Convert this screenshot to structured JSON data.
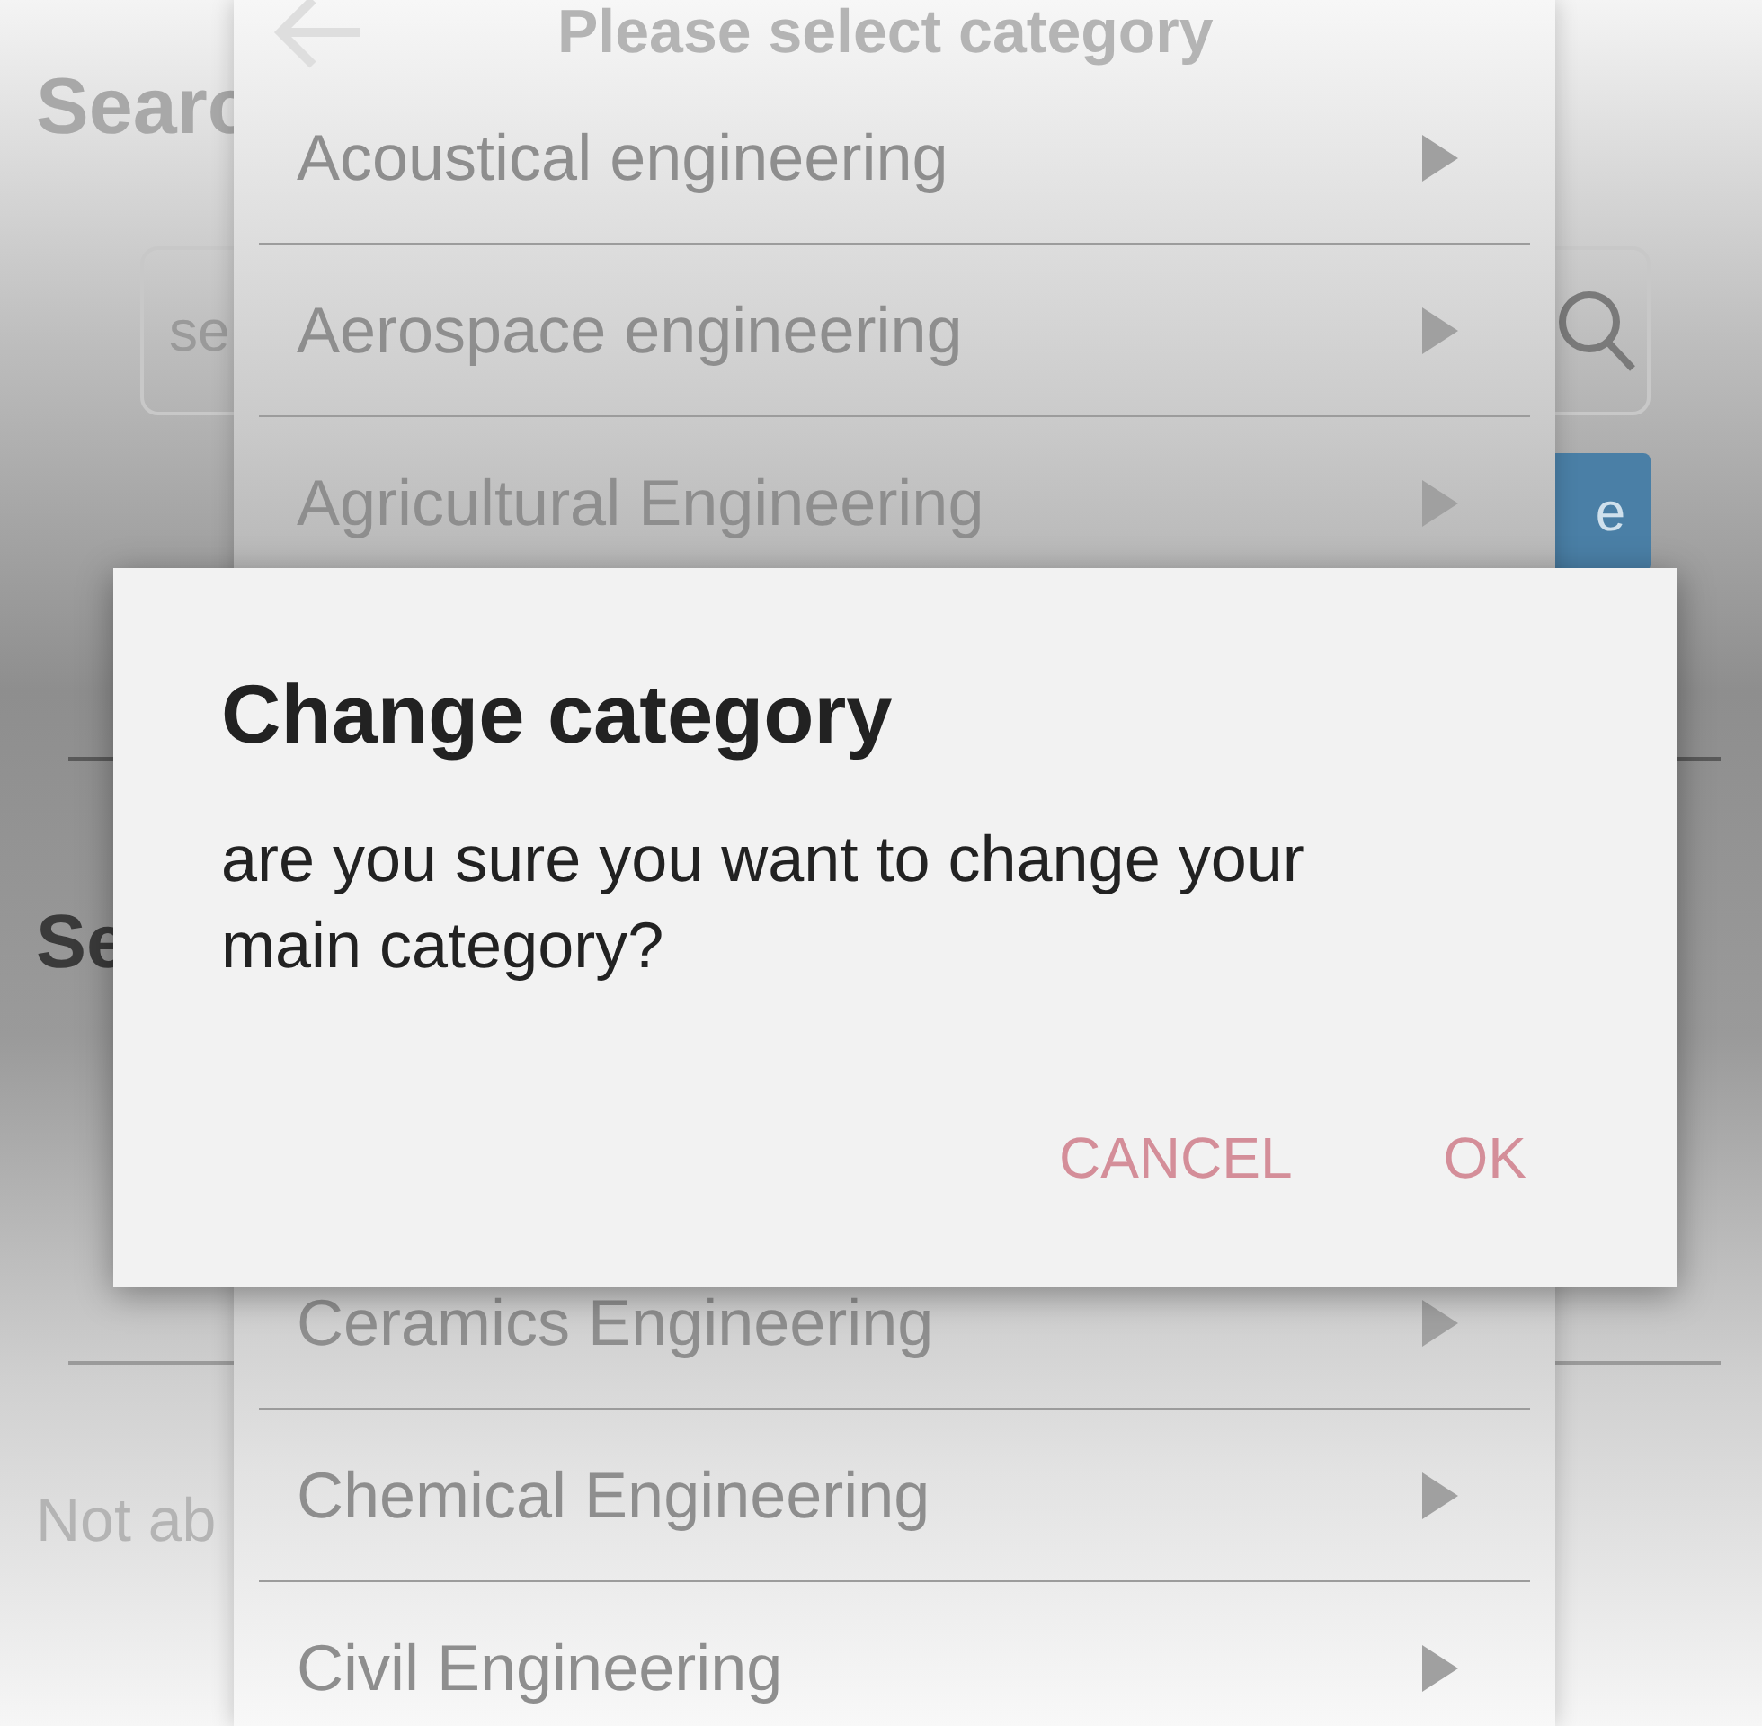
{
  "page": {
    "title": "Searc",
    "search": {
      "placeholder": "se"
    },
    "search_button": "e",
    "section_title": "Se",
    "note": "Not ab"
  },
  "category_sheet": {
    "title": "Please select category",
    "items": [
      {
        "label": "Acoustical engineering"
      },
      {
        "label": "Aerospace engineering"
      },
      {
        "label": "Agricultural Engineering"
      },
      {
        "label": "Ceramics Engineering"
      },
      {
        "label": "Chemical Engineering"
      },
      {
        "label": "Civil Engineering"
      }
    ]
  },
  "dialog": {
    "title": "Change category",
    "message": "are you sure you want to change your main category?",
    "buttons": [
      "CANCEL",
      "OK"
    ]
  }
}
